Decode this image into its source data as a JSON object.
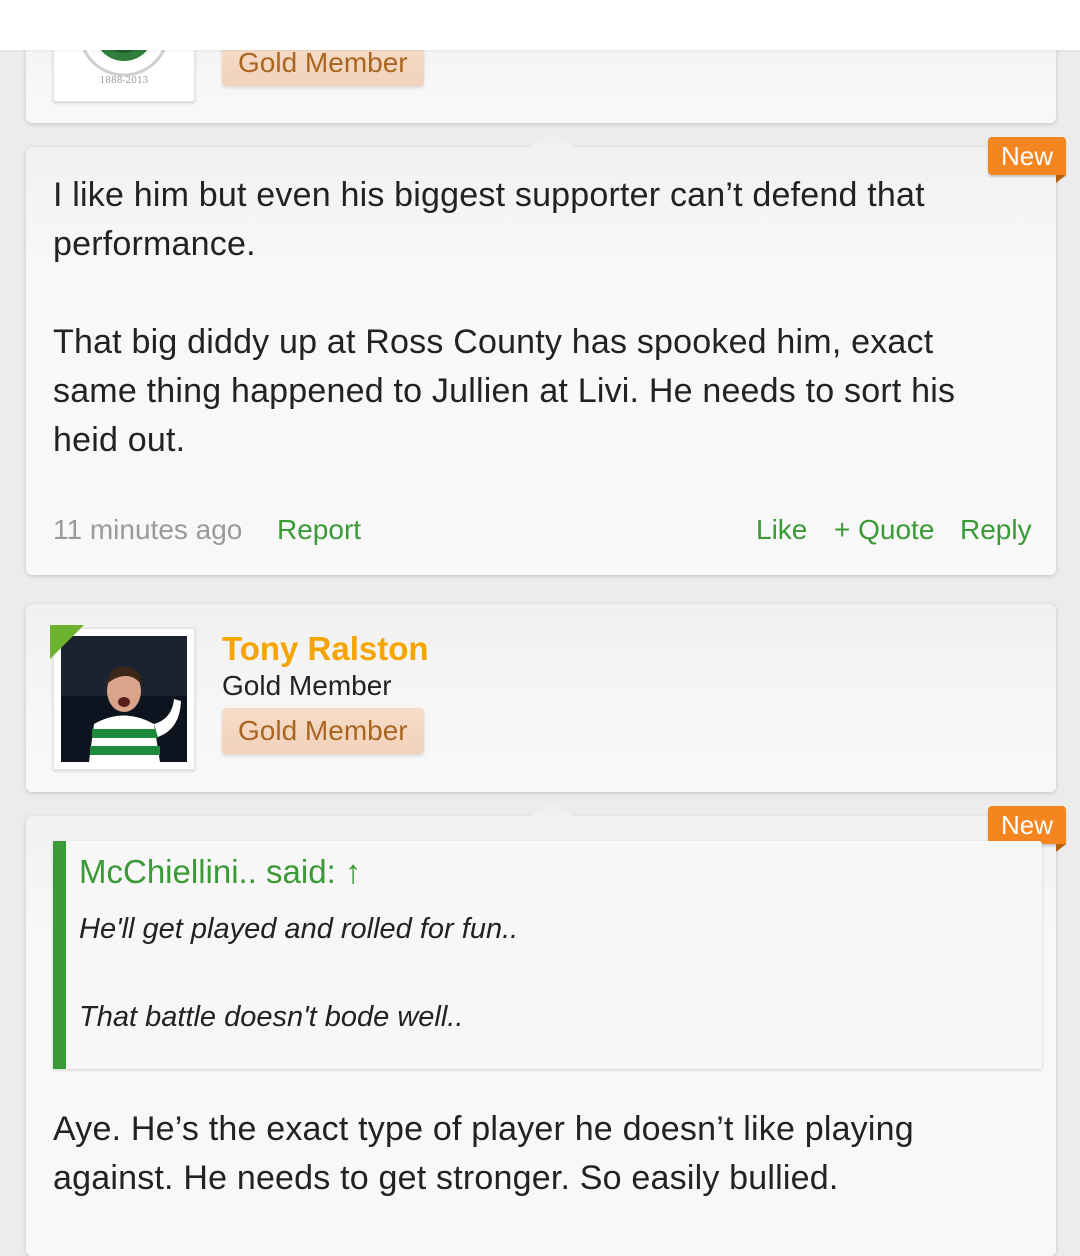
{
  "posts": [
    {
      "user": {
        "badge": "Gold Member"
      }
    },
    {
      "is_new": "New",
      "paragraphs": [
        "I like him but even his biggest supporter can’t defend that performance.",
        "That big diddy up at Ross County has spooked him, exact same thing happened to Jullien at Livi. He needs to sort his heid out."
      ],
      "footer": {
        "time": "11 minutes ago",
        "report": "Report",
        "like": "Like",
        "quote": "+ Quote",
        "reply": "Reply"
      }
    },
    {
      "user": {
        "name": "Tony Ralston",
        "title": "Gold Member",
        "badge": "Gold Member"
      },
      "is_new": "New",
      "quote": {
        "author": "McChiellini.. said: ↑",
        "lines": [
          "He'll get played and rolled for fun..",
          "That battle doesn't bode well.."
        ]
      },
      "paragraphs": [
        "Aye. He’s the exact type of player he doesn’t like playing against. He needs to get stronger. So easily bullied."
      ]
    }
  ],
  "colors": {
    "accent_green": "#3a9a36",
    "username_orange": "#f5a400",
    "new_flag": "#f5861f",
    "badge_bg": "#f4d6c0",
    "badge_text": "#a96622"
  }
}
